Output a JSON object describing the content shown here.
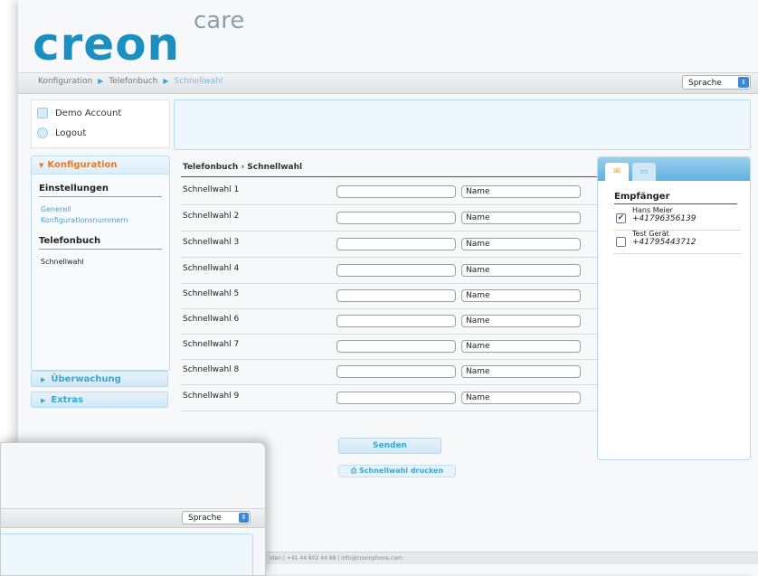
{
  "logo": {
    "main": "creon",
    "sup": "care"
  },
  "breadcrumb": [
    "Konfiguration",
    "Telefonbuch",
    "Schnellwahl"
  ],
  "language_select": {
    "selected": "Sprache"
  },
  "account": {
    "name": "Demo Account",
    "logout": "Logout"
  },
  "nav": {
    "open_section": "Konfiguration",
    "groups": [
      {
        "title": "Einstellungen",
        "links": [
          "Generell",
          "Konfigurationsnummern"
        ]
      },
      {
        "title": "Telefonbuch",
        "items": [
          "Schnellwahl"
        ]
      }
    ],
    "collapsed": [
      "Überwachung",
      "Extras"
    ]
  },
  "main": {
    "title": "Telefonbuch › Schnellwahl",
    "rows": [
      {
        "label": "Schnellwahl 1",
        "number": "",
        "name": "Name"
      },
      {
        "label": "Schnellwahl 2",
        "number": "",
        "name": "Name"
      },
      {
        "label": "Schnellwahl 3",
        "number": "",
        "name": "Name"
      },
      {
        "label": "Schnellwahl 4",
        "number": "",
        "name": "Name"
      },
      {
        "label": "Schnellwahl 5",
        "number": "",
        "name": "Name"
      },
      {
        "label": "Schnellwahl 6",
        "number": "",
        "name": "Name"
      },
      {
        "label": "Schnellwahl 7",
        "number": "",
        "name": "Name"
      },
      {
        "label": "Schnellwahl 8",
        "number": "",
        "name": "Name"
      },
      {
        "label": "Schnellwahl 9",
        "number": "",
        "name": "Name"
      }
    ],
    "send_button": "Senden",
    "print_button": "Schnellwahl drucken"
  },
  "recipients": {
    "title": "Empfänger",
    "items": [
      {
        "name": "Hans Meier",
        "phone": "+41796356139",
        "checked": true
      },
      {
        "name": "Test Gerät",
        "phone": "+41795443712",
        "checked": false
      }
    ]
  },
  "footer": {
    "text": "iden | +41 44 802 44 88 | info@creonphone.com"
  },
  "second_window": {
    "language_select": "Sprache"
  },
  "colors": {
    "accent": "#3aa6d6",
    "brand": "#1b8fc0",
    "active_section": "#e8792b"
  }
}
